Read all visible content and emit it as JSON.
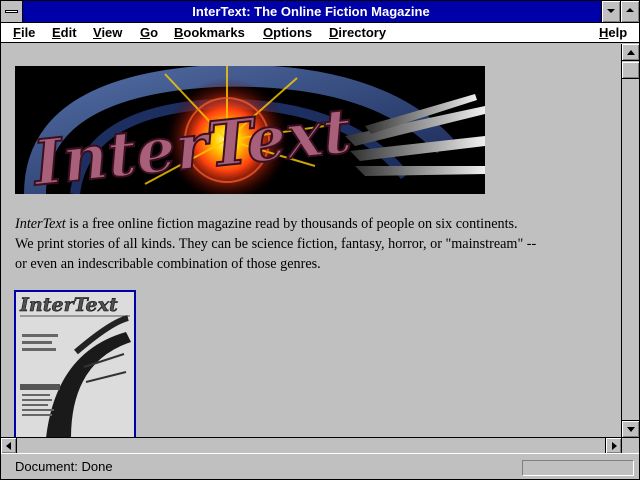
{
  "window": {
    "title": "InterText: The Online Fiction Magazine"
  },
  "menubar": {
    "items": [
      "File",
      "Edit",
      "View",
      "Go",
      "Bookmarks",
      "Options",
      "Directory"
    ],
    "help": "Help"
  },
  "content": {
    "banner": {
      "logo_text": "InterText"
    },
    "intro": {
      "title": "InterText",
      "rest_line1": " is a free online fiction magazine read by thousands of people on six continents.",
      "line2": "We print stories of all kinds. They can be science fiction, fantasy, horror, or \"mainstream\" --",
      "line3": "or even an indescribable combination of those genres."
    },
    "cover": {
      "logo_text": "InterText"
    }
  },
  "statusbar": {
    "text": "Document: Done"
  },
  "colors": {
    "titlebar": "#0000a8",
    "chrome": "#c0c0c0"
  },
  "icons": [
    "system-menu-icon",
    "minimize-icon",
    "maximize-icon",
    "scroll-up-icon",
    "scroll-down-icon",
    "scroll-left-icon",
    "scroll-right-icon"
  ]
}
